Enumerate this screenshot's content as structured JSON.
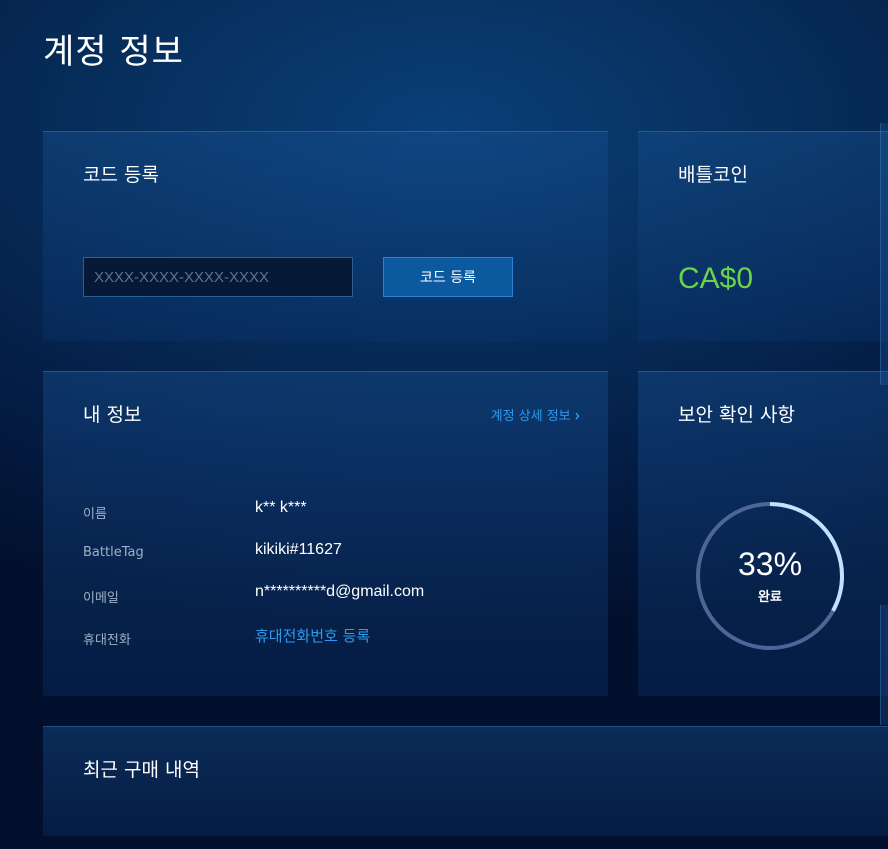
{
  "page": {
    "title": "계정 정보"
  },
  "colors": {
    "accent_link": "#2a9bf0",
    "coin_green": "#6bd34a",
    "ring_track": "#4d6597",
    "ring_progress": "#bfe3ff"
  },
  "code_redeem": {
    "title": "코드 등록",
    "input_value": "",
    "input_placeholder": "XXXX-XXXX-XXXX-XXXX",
    "button_label": "코드 등록"
  },
  "battle_coin": {
    "title": "배틀코인",
    "amount": "CA$0"
  },
  "my_info": {
    "title": "내 정보",
    "details_link": "계정 상세 정보",
    "details_link_icon": "chevron-right-icon",
    "rows": [
      {
        "label": "이름",
        "value": "k** k***"
      },
      {
        "label": "BattleTag",
        "value": "kikiki#11627"
      },
      {
        "label": "이메일",
        "value": "n**********d@gmail.com"
      },
      {
        "label": "휴대전화",
        "value": "휴대전화번호 등록"
      }
    ]
  },
  "security": {
    "title": "보안 확인 사항",
    "progress_percent": 33,
    "progress_label": "33%",
    "caption": "완료"
  },
  "recent_purchases": {
    "title": "최근 구매 내역"
  }
}
